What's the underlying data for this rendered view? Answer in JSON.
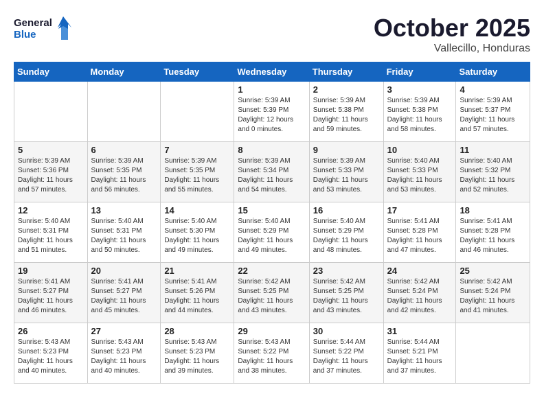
{
  "header": {
    "logo_general": "General",
    "logo_blue": "Blue",
    "month_title": "October 2025",
    "location": "Vallecillo, Honduras"
  },
  "weekdays": [
    "Sunday",
    "Monday",
    "Tuesday",
    "Wednesday",
    "Thursday",
    "Friday",
    "Saturday"
  ],
  "weeks": [
    [
      {
        "day": "",
        "info": ""
      },
      {
        "day": "",
        "info": ""
      },
      {
        "day": "",
        "info": ""
      },
      {
        "day": "1",
        "info": "Sunrise: 5:39 AM\nSunset: 5:39 PM\nDaylight: 12 hours\nand 0 minutes."
      },
      {
        "day": "2",
        "info": "Sunrise: 5:39 AM\nSunset: 5:38 PM\nDaylight: 11 hours\nand 59 minutes."
      },
      {
        "day": "3",
        "info": "Sunrise: 5:39 AM\nSunset: 5:38 PM\nDaylight: 11 hours\nand 58 minutes."
      },
      {
        "day": "4",
        "info": "Sunrise: 5:39 AM\nSunset: 5:37 PM\nDaylight: 11 hours\nand 57 minutes."
      }
    ],
    [
      {
        "day": "5",
        "info": "Sunrise: 5:39 AM\nSunset: 5:36 PM\nDaylight: 11 hours\nand 57 minutes."
      },
      {
        "day": "6",
        "info": "Sunrise: 5:39 AM\nSunset: 5:35 PM\nDaylight: 11 hours\nand 56 minutes."
      },
      {
        "day": "7",
        "info": "Sunrise: 5:39 AM\nSunset: 5:35 PM\nDaylight: 11 hours\nand 55 minutes."
      },
      {
        "day": "8",
        "info": "Sunrise: 5:39 AM\nSunset: 5:34 PM\nDaylight: 11 hours\nand 54 minutes."
      },
      {
        "day": "9",
        "info": "Sunrise: 5:39 AM\nSunset: 5:33 PM\nDaylight: 11 hours\nand 53 minutes."
      },
      {
        "day": "10",
        "info": "Sunrise: 5:40 AM\nSunset: 5:33 PM\nDaylight: 11 hours\nand 53 minutes."
      },
      {
        "day": "11",
        "info": "Sunrise: 5:40 AM\nSunset: 5:32 PM\nDaylight: 11 hours\nand 52 minutes."
      }
    ],
    [
      {
        "day": "12",
        "info": "Sunrise: 5:40 AM\nSunset: 5:31 PM\nDaylight: 11 hours\nand 51 minutes."
      },
      {
        "day": "13",
        "info": "Sunrise: 5:40 AM\nSunset: 5:31 PM\nDaylight: 11 hours\nand 50 minutes."
      },
      {
        "day": "14",
        "info": "Sunrise: 5:40 AM\nSunset: 5:30 PM\nDaylight: 11 hours\nand 49 minutes."
      },
      {
        "day": "15",
        "info": "Sunrise: 5:40 AM\nSunset: 5:29 PM\nDaylight: 11 hours\nand 49 minutes."
      },
      {
        "day": "16",
        "info": "Sunrise: 5:40 AM\nSunset: 5:29 PM\nDaylight: 11 hours\nand 48 minutes."
      },
      {
        "day": "17",
        "info": "Sunrise: 5:41 AM\nSunset: 5:28 PM\nDaylight: 11 hours\nand 47 minutes."
      },
      {
        "day": "18",
        "info": "Sunrise: 5:41 AM\nSunset: 5:28 PM\nDaylight: 11 hours\nand 46 minutes."
      }
    ],
    [
      {
        "day": "19",
        "info": "Sunrise: 5:41 AM\nSunset: 5:27 PM\nDaylight: 11 hours\nand 46 minutes."
      },
      {
        "day": "20",
        "info": "Sunrise: 5:41 AM\nSunset: 5:27 PM\nDaylight: 11 hours\nand 45 minutes."
      },
      {
        "day": "21",
        "info": "Sunrise: 5:41 AM\nSunset: 5:26 PM\nDaylight: 11 hours\nand 44 minutes."
      },
      {
        "day": "22",
        "info": "Sunrise: 5:42 AM\nSunset: 5:25 PM\nDaylight: 11 hours\nand 43 minutes."
      },
      {
        "day": "23",
        "info": "Sunrise: 5:42 AM\nSunset: 5:25 PM\nDaylight: 11 hours\nand 43 minutes."
      },
      {
        "day": "24",
        "info": "Sunrise: 5:42 AM\nSunset: 5:24 PM\nDaylight: 11 hours\nand 42 minutes."
      },
      {
        "day": "25",
        "info": "Sunrise: 5:42 AM\nSunset: 5:24 PM\nDaylight: 11 hours\nand 41 minutes."
      }
    ],
    [
      {
        "day": "26",
        "info": "Sunrise: 5:43 AM\nSunset: 5:23 PM\nDaylight: 11 hours\nand 40 minutes."
      },
      {
        "day": "27",
        "info": "Sunrise: 5:43 AM\nSunset: 5:23 PM\nDaylight: 11 hours\nand 40 minutes."
      },
      {
        "day": "28",
        "info": "Sunrise: 5:43 AM\nSunset: 5:23 PM\nDaylight: 11 hours\nand 39 minutes."
      },
      {
        "day": "29",
        "info": "Sunrise: 5:43 AM\nSunset: 5:22 PM\nDaylight: 11 hours\nand 38 minutes."
      },
      {
        "day": "30",
        "info": "Sunrise: 5:44 AM\nSunset: 5:22 PM\nDaylight: 11 hours\nand 37 minutes."
      },
      {
        "day": "31",
        "info": "Sunrise: 5:44 AM\nSunset: 5:21 PM\nDaylight: 11 hours\nand 37 minutes."
      },
      {
        "day": "",
        "info": ""
      }
    ]
  ]
}
